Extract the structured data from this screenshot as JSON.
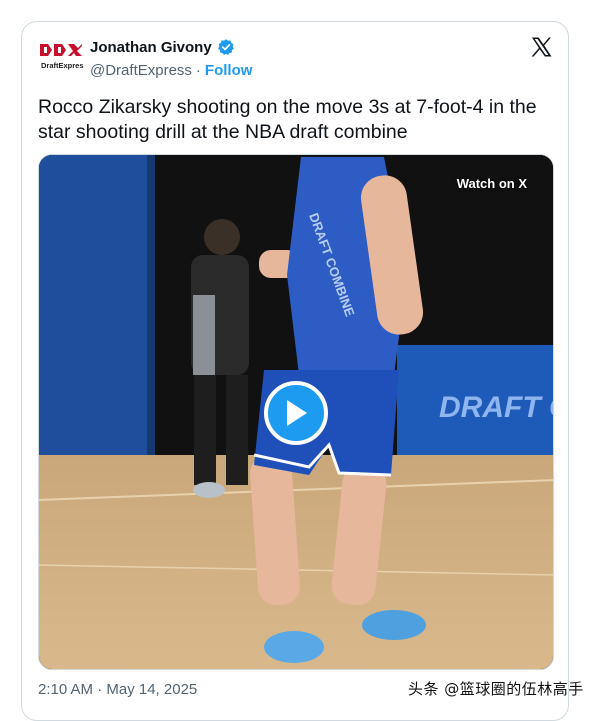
{
  "author": {
    "logo_text": "DraftExpress",
    "name": "Jonathan Givony",
    "handle": "@DraftExpress",
    "separator": "·",
    "follow_label": "Follow",
    "verified_icon": "verified-badge-icon",
    "brand_color": "#c8102e"
  },
  "tweet": {
    "text": "Rocco Zikarsky shooting on the move 3s at 7-foot-4 in the star shooting drill at the NBA draft combine"
  },
  "media": {
    "watch_label": "Watch on X",
    "play_icon": "play-icon",
    "accent": "#1d9bf0",
    "banner_text": "DRAFT CO",
    "jersey_text": "DRAFT COMBINE"
  },
  "meta": {
    "timestamp": "2:10 AM · May 14, 2025"
  },
  "watermark": {
    "text": "头条 @篮球圈的伍林高手"
  }
}
